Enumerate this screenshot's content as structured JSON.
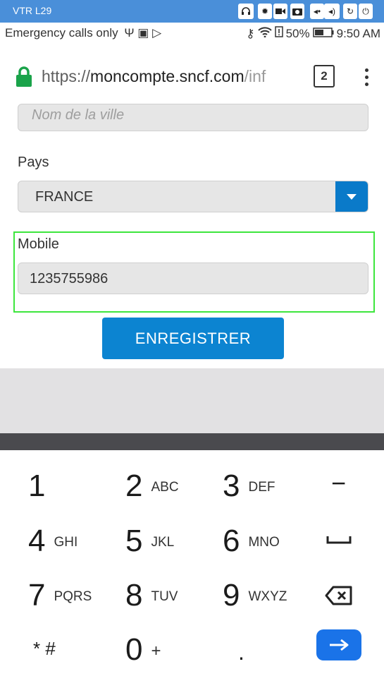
{
  "device": {
    "name": "VTR L29",
    "buttons": [
      "headset-icon",
      "settings-icon",
      "video-icon",
      "camera-icon",
      "volume-down-icon",
      "volume-up-icon",
      "rotate-icon",
      "power-icon"
    ]
  },
  "statusbar": {
    "left_text": "Emergency calls only",
    "battery": "50%",
    "time": "9:50 AM"
  },
  "browser": {
    "url_scheme": "https://",
    "url_host": "moncompte.sncf.com",
    "url_path": "/inf",
    "tab_count": "2"
  },
  "form": {
    "city_placeholder": "Nom de la ville",
    "country_label": "Pays",
    "country_value": "FRANCE",
    "mobile_label": "Mobile",
    "mobile_value": "1235755986",
    "submit_label": "ENREGISTRER"
  },
  "keypad": {
    "keys": [
      {
        "num": "1",
        "sub": ""
      },
      {
        "num": "2",
        "sub": "ABC"
      },
      {
        "num": "3",
        "sub": "DEF"
      },
      {
        "num": "4",
        "sub": "GHI"
      },
      {
        "num": "5",
        "sub": "JKL"
      },
      {
        "num": "6",
        "sub": "MNO"
      },
      {
        "num": "7",
        "sub": "PQRS"
      },
      {
        "num": "8",
        "sub": "TUV"
      },
      {
        "num": "9",
        "sub": "WXYZ"
      },
      {
        "num": "* #",
        "sub": ""
      },
      {
        "num": "0",
        "sub": "+"
      },
      {
        "num": ".",
        "sub": ""
      }
    ],
    "minus": "−"
  },
  "colors": {
    "device_bar": "#4a8fd9",
    "accent_blue": "#0c84d1",
    "highlight_green": "#3de63d",
    "lock_green": "#1aa34a"
  }
}
